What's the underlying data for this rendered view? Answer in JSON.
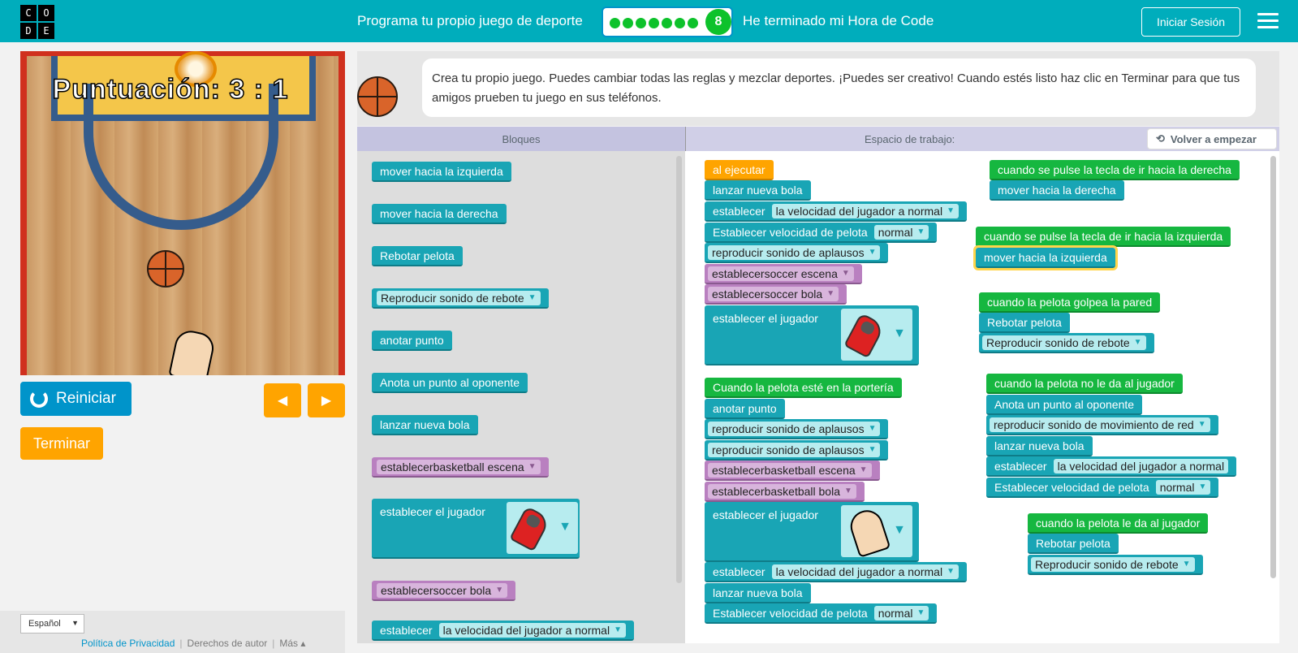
{
  "header": {
    "logo_letters": [
      "C",
      "O",
      "D",
      "E"
    ],
    "lesson_title": "Programa tu propio juego de deporte",
    "current_level": "8",
    "finished_text": "He terminado mi Hora de Code",
    "signin_label": "Iniciar Sesión"
  },
  "game": {
    "score_text": "Puntuación: 3 : 1",
    "reset_label": "Reiniciar",
    "finish_label": "Terminar",
    "left_arrow": "◀",
    "right_arrow": "▶"
  },
  "footer": {
    "language": "Español",
    "privacy": "Política de Privacidad",
    "copyright": "Derechos de autor",
    "more": "Más ▴"
  },
  "instructions": {
    "text": "Crea tu propio juego. Puedes cambiar todas las reglas y mezclar deportes. ¡Puedes ser creativo! Cuando estés listo haz clic en Terminar para que tus amigos prueben tu juego en sus teléfonos."
  },
  "editor": {
    "toolbox_title": "Bloques",
    "workspace_title": "Espacio de trabajo:",
    "restart_label": "Volver a empezar"
  },
  "toolbox": {
    "move_left": "mover hacia la izquierda",
    "move_right": "mover hacia la derecha",
    "bounce": "Rebotar pelota",
    "bounce_sound": "Reproducir sonido de rebote",
    "score": "anotar punto",
    "score_opponent": "Anota un punto al oponente",
    "launch_ball": "lanzar nueva bola",
    "basketball_scene": "establecerbasketball escena",
    "set_player": "establecer el jugador",
    "soccer_ball": "establecersoccer bola",
    "set_speed": "establecer",
    "set_speed_value": "la velocidad del jugador a normal"
  },
  "workspace": {
    "on_run": "al ejecutar",
    "launch_ball": "lanzar nueva bola",
    "set_label": "establecer",
    "player_speed_normal": "la velocidad del jugador a normal",
    "ball_speed_label": "Establecer velocidad de pelota",
    "normal": "normal",
    "play_applause": "reproducir sonido de aplausos",
    "soccer_scene": "establecersoccer escena",
    "soccer_ball": "establecersoccer bola",
    "set_player": "establecer el jugador",
    "on_goal": "Cuando la pelota esté en la portería",
    "score": "anotar punto",
    "basketball_scene": "establecerbasketball escena",
    "basketball_ball": "establecerbasketball bola",
    "on_right_key": "cuando se pulse la tecla de ir hacia la derecha",
    "move_right": "mover hacia la derecha",
    "on_left_key": "cuando se pulse la tecla de ir hacia la izquierda",
    "move_left": "mover hacia la izquierda",
    "on_wall_hit": "cuando la pelota golpea la pared",
    "bounce": "Rebotar pelota",
    "bounce_sound": "Reproducir sonido de rebote",
    "on_miss": "cuando la pelota no le da al jugador",
    "score_opponent": "Anota un punto al oponente",
    "net_sound": "reproducir sonido de movimiento de red",
    "on_hit_player": "cuando la pelota le da al jugador"
  }
}
